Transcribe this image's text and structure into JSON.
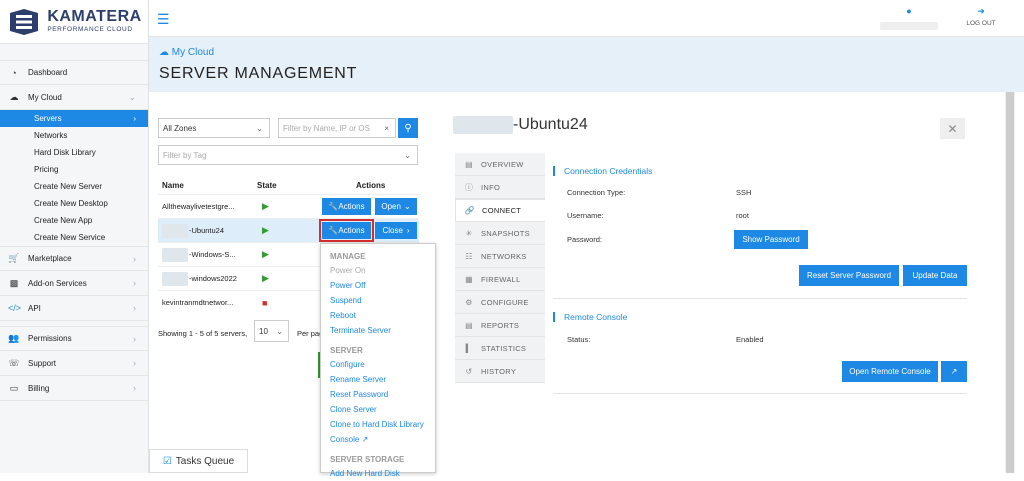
{
  "logo": {
    "brand": "KAMATERA",
    "tagline": "PERFORMANCE CLOUD"
  },
  "sidebar": {
    "items": [
      {
        "label": "Dashboard",
        "icon": "dashboard-icon"
      },
      {
        "label": "My Cloud",
        "icon": "cloud-icon"
      }
    ],
    "my_cloud_sub": [
      "Servers",
      "Networks",
      "Hard Disk Library",
      "Pricing",
      "Create New Server",
      "Create New Desktop",
      "Create New App",
      "Create New Service"
    ],
    "items2": [
      {
        "label": "Marketplace",
        "icon": "cart-icon"
      },
      {
        "label": "Add-on Services",
        "icon": "addon-icon"
      },
      {
        "label": "API",
        "icon": "code-icon"
      },
      {
        "label": "Permissions",
        "icon": "users-icon"
      },
      {
        "label": "Support",
        "icon": "headset-icon"
      },
      {
        "label": "Billing",
        "icon": "credit-card-icon"
      }
    ]
  },
  "tasks_queue": "Tasks Queue",
  "topbar": {
    "logout": "LOG OUT"
  },
  "header": {
    "breadcrumb": "My Cloud",
    "title": "SERVER MANAGEMENT"
  },
  "filters": {
    "zone": "All Zones",
    "search_placeholder": "Filter by Name, IP or OS",
    "tag_placeholder": "Filter by Tag"
  },
  "table": {
    "headers": {
      "name": "Name",
      "state": "State",
      "actions": "Actions"
    },
    "rows": [
      {
        "name": "Alltheway​livetestgre...",
        "state": "running",
        "btn1": "Actions",
        "btn2": "Open"
      },
      {
        "name": "-Ubuntu24",
        "state": "running",
        "btn1": "Actions",
        "btn2": "Close"
      },
      {
        "name": "-Windows-S...",
        "state": "running"
      },
      {
        "name": "-windows2022",
        "state": "running"
      },
      {
        "name": "kevintranmdtnetwor...",
        "state": "stopped"
      }
    ],
    "showing": "Showing 1 - 5 of 5 servers,",
    "per_page_value": "10",
    "per_page_label": "Per page"
  },
  "menu": {
    "manage_header": "MANAGE",
    "manage": [
      "Power On",
      "Power Off",
      "Suspend",
      "Reboot",
      "Terminate Server"
    ],
    "server_header": "SERVER",
    "server": [
      "Configure",
      "Rename Server",
      "Reset Password",
      "Clone Server",
      "Clone to Hard Disk Library",
      "Console"
    ],
    "storage_header": "SERVER STORAGE",
    "storage": [
      "Add New Hard Disk"
    ]
  },
  "detail": {
    "title": "-Ubuntu24",
    "tabs": [
      {
        "label": "OVERVIEW",
        "icon": "file-icon"
      },
      {
        "label": "INFO",
        "icon": "info-icon"
      },
      {
        "label": "CONNECT",
        "icon": "link-icon"
      },
      {
        "label": "SNAPSHOTS",
        "icon": "pin-icon"
      },
      {
        "label": "NETWORKS",
        "icon": "network-icon"
      },
      {
        "label": "FIREWALL",
        "icon": "firewall-icon"
      },
      {
        "label": "CONFIGURE",
        "icon": "cogs-icon"
      },
      {
        "label": "REPORTS",
        "icon": "report-icon"
      },
      {
        "label": "STATISTICS",
        "icon": "bar-chart-icon"
      },
      {
        "label": "HISTORY",
        "icon": "history-icon"
      }
    ],
    "conn": {
      "title": "Connection Credentials",
      "type_label": "Connection Type:",
      "type_value": "SSH",
      "user_label": "Username:",
      "user_value": "root",
      "pass_label": "Password:",
      "show_password": "Show Password",
      "reset_password": "Reset Server Password",
      "update_data": "Update Data"
    },
    "remote": {
      "title": "Remote Console",
      "status_label": "Status:",
      "status_value": "Enabled",
      "open_console": "Open Remote Console"
    }
  },
  "colors": {
    "accent": "#1e88e5",
    "running": "#2e9c2e",
    "stopped": "#d32f2f"
  }
}
